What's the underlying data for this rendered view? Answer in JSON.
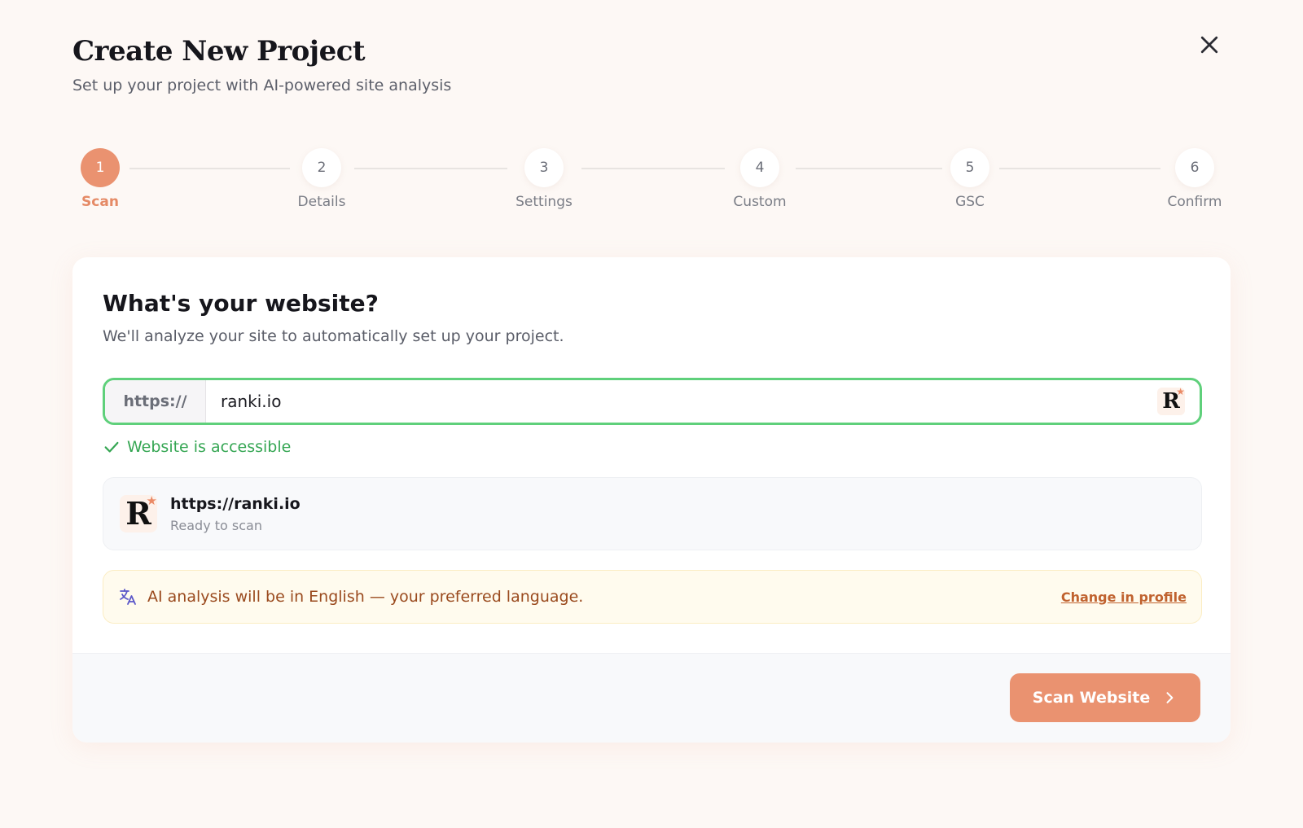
{
  "header": {
    "title": "Create New Project",
    "subtitle": "Set up your project with AI-powered site analysis"
  },
  "stepper": {
    "active_step": 1,
    "steps": [
      {
        "number": "1",
        "label": "Scan"
      },
      {
        "number": "2",
        "label": "Details"
      },
      {
        "number": "3",
        "label": "Settings"
      },
      {
        "number": "4",
        "label": "Custom"
      },
      {
        "number": "5",
        "label": "GSC"
      },
      {
        "number": "6",
        "label": "Confirm"
      }
    ]
  },
  "card": {
    "title": "What's your website?",
    "description": "We'll analyze your site to automatically set up your project.",
    "url_field": {
      "prefix": "https://",
      "value": "ranki.io",
      "favicon_icon": "ranki-logo-icon"
    },
    "status": {
      "text": "Website is accessible",
      "icon": "check-icon"
    },
    "site_preview": {
      "logo_icon": "ranki-logo-icon",
      "logo_letter": "R",
      "url": "https://ranki.io",
      "status": "Ready to scan"
    },
    "language_notice": {
      "icon": "translate-icon",
      "text": "AI analysis will be in English — your preferred language.",
      "link": "Change in profile"
    },
    "footer": {
      "scan_button": "Scan Website",
      "scan_button_icon": "chevron-right-icon"
    }
  },
  "colors": {
    "accent": "#ea9270",
    "success": "#35a653",
    "success_border": "#5fd07b",
    "notice_bg": "#fffbee",
    "notice_text": "#9a4a1e",
    "background": "#fdf8f5"
  }
}
